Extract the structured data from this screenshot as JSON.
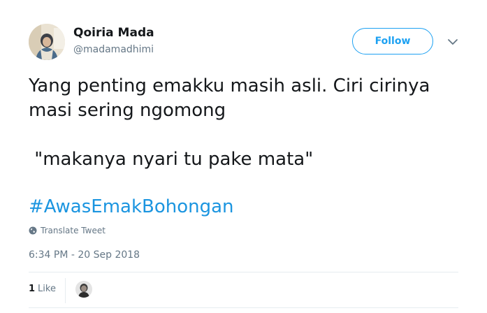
{
  "author": {
    "name": "Qoiria Mada",
    "handle": "@madamadhimi"
  },
  "header": {
    "follow_label": "Follow",
    "caret_icon": "chevron-down-icon"
  },
  "tweet": {
    "lines": [
      "Yang penting emakku masih asli. Ciri cirinya",
      "masi sering ngomong",
      " \"makanya nyari tu pake mata\""
    ],
    "hashtag": "#AwasEmakBohongan",
    "translate_label": "Translate Tweet",
    "timestamp": "6:34 PM - 20 Sep 2018"
  },
  "stats": {
    "like_count": "1",
    "like_label": "Like"
  },
  "colors": {
    "accent": "#1da1f2",
    "hashtag": "#1b95e0",
    "secondary_text": "#657786",
    "divider": "#e6ecf0"
  }
}
